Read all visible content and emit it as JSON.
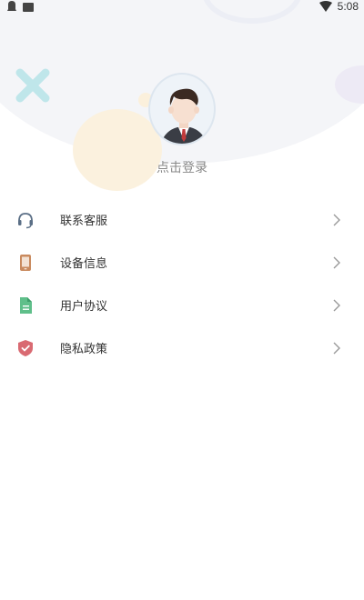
{
  "status_bar": {
    "time": "5:08"
  },
  "profile": {
    "login_prompt": "点击登录"
  },
  "menu": {
    "items": [
      {
        "label": "联系客服",
        "icon": "headset-icon",
        "color": "#5b6f86"
      },
      {
        "label": "设备信息",
        "icon": "phone-icon",
        "color": "#c98a5e"
      },
      {
        "label": "用户协议",
        "icon": "document-icon",
        "color": "#5fbf8a"
      },
      {
        "label": "隐私政策",
        "icon": "shield-icon",
        "color": "#d96a72"
      }
    ]
  },
  "colors": {
    "header_background": "#f4f5f8",
    "accent_x": "#bfe6ea",
    "deco_yellow": "#fbf0dc"
  }
}
